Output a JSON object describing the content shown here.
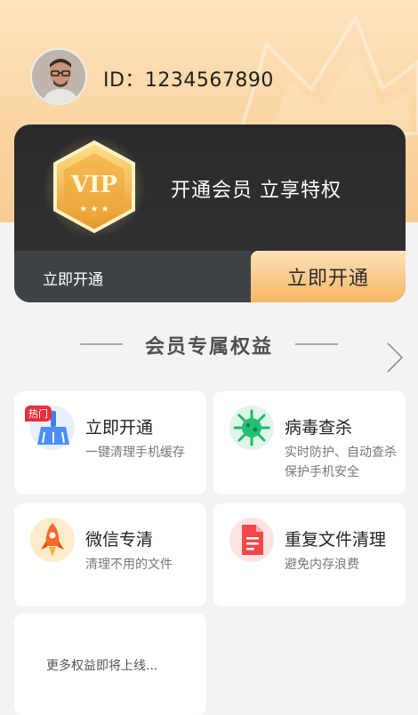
{
  "header": {
    "user_id_text": "ID：1234567890"
  },
  "vip": {
    "badge_text": "VIP",
    "slogan": "开通会员  立享特权",
    "left_label": "立即开通",
    "button_label": "立即开通"
  },
  "section": {
    "title": "会员专属权益"
  },
  "benefits": [
    {
      "title": "立即开通",
      "desc": "一键清理手机缓存",
      "tag": "热门",
      "icon": "broom-icon"
    },
    {
      "title": "病毒查杀",
      "desc": "实时防护、自动查杀保护手机安全",
      "icon": "virus-icon"
    },
    {
      "title": "微信专清",
      "desc": "清理不用的文件",
      "icon": "rocket-icon"
    },
    {
      "title": "重复文件清理",
      "desc": "避免内存浪费",
      "icon": "document-icon"
    }
  ],
  "more": {
    "text": "更多权益即将上线..."
  },
  "colors": {
    "top_gradient": "#fbd4a0",
    "vip_card_bg": "#2a2a2c",
    "button_gold": "#f6b664",
    "hot_red": "#e8303a",
    "page_bg": "#f3f3f5"
  }
}
